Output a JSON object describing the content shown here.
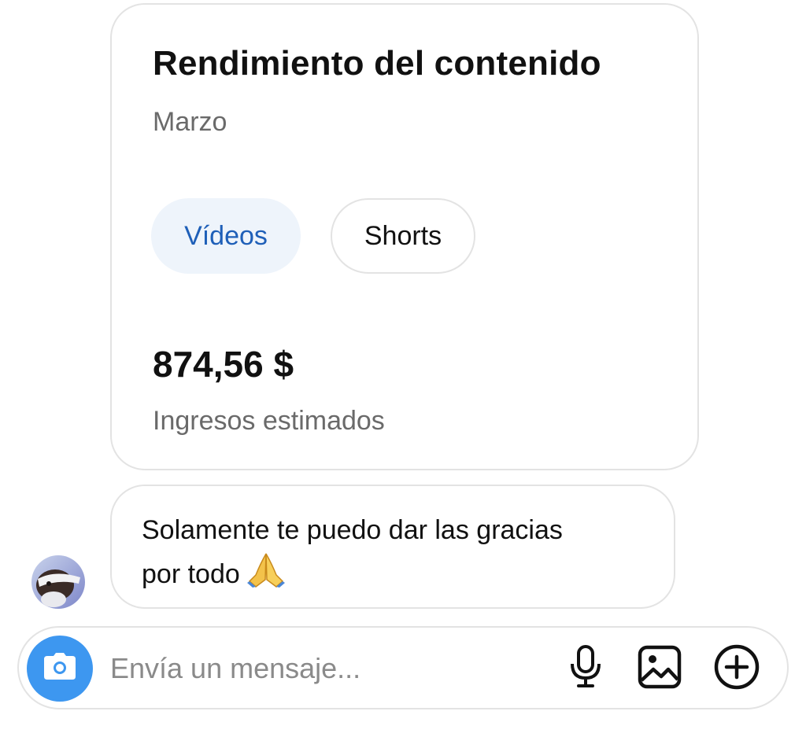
{
  "card": {
    "title": "Rendimiento del contenido",
    "subtitle": "Marzo",
    "tabs": [
      {
        "label": "Vídeos",
        "selected": true
      },
      {
        "label": "Shorts",
        "selected": false
      }
    ],
    "amount": "874,56 $",
    "amount_label": "Ingresos estimados"
  },
  "message": {
    "text": "Solamente te puedo dar las gracias\npor todo",
    "emoji": "folded-hands"
  },
  "composer": {
    "placeholder": "Envía un mensaje...",
    "icons": [
      "camera-icon",
      "microphone-icon",
      "image-icon",
      "plus-circle-icon"
    ]
  },
  "colors": {
    "accent": "#3d97f0",
    "selected_tab_bg": "#eef4fb",
    "selected_tab_text": "#1e5fb8",
    "border": "#e3e3e3",
    "secondary_text": "#6a6a6a"
  }
}
